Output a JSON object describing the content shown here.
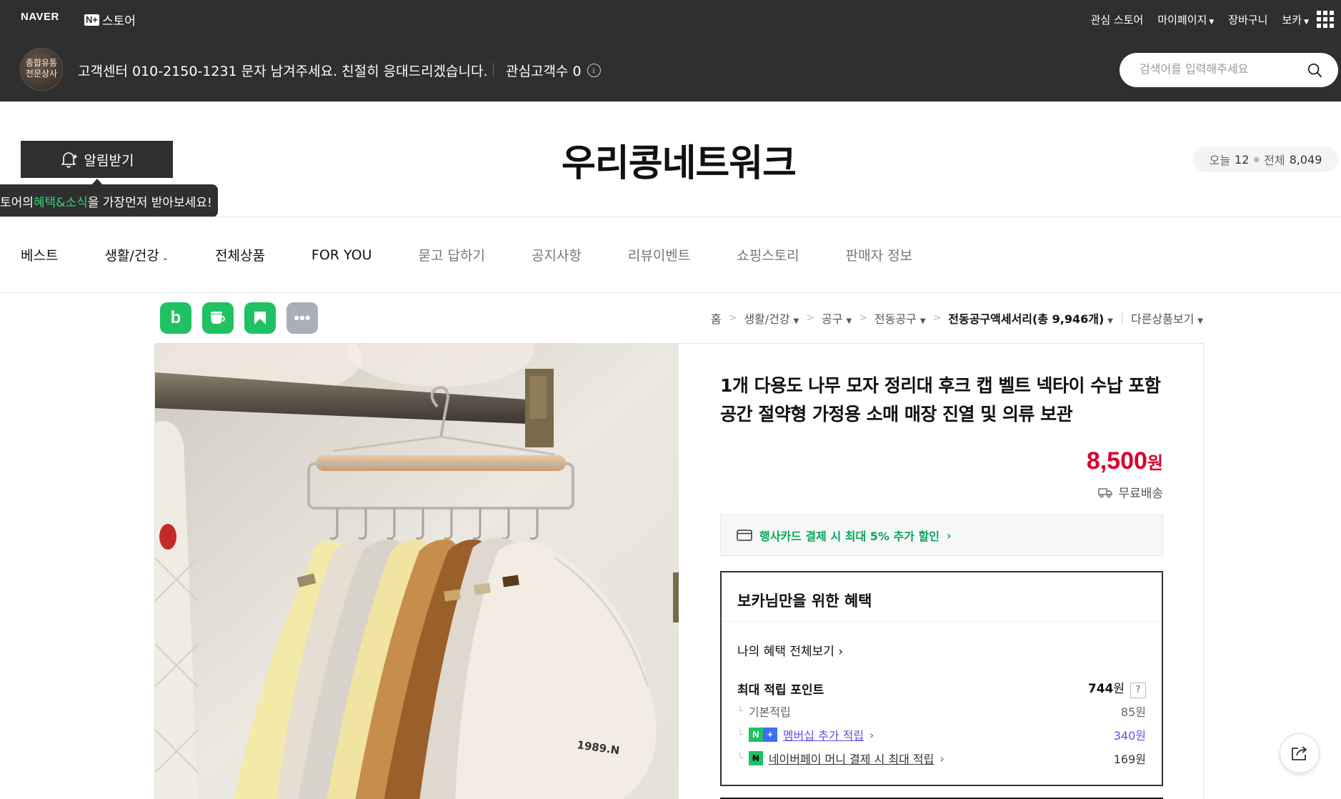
{
  "topbar": {
    "naver_logo": "NAVER",
    "nplus_badge": "N+",
    "nplus_store": "스토어",
    "menu": [
      "관심 스토어",
      "마이페이지",
      "장바구니",
      "보카"
    ],
    "store_avatar_text": "종합유통\n전문상사",
    "customer_center": "고객센터 010-2150-1231 문자 남겨주세요. 친절히 응대드리겠습니다.",
    "fav_customers": "관심고객수 0",
    "search_placeholder": "검색어를 입력해주세요"
  },
  "header": {
    "alarm_button": "알림받기",
    "tooltip_pre": "토어의 ",
    "tooltip_hl": "혜택&소식",
    "tooltip_post": "을 가장먼저 받아보세요!",
    "store_name": "우리콩네트워크",
    "today_label": "오늘",
    "today_count": "12",
    "total_label": "전체",
    "total_count": "8,049"
  },
  "nav": {
    "items": [
      "베스트",
      "생활/건강",
      "전체상품",
      "FOR YOU",
      "묻고 답하기",
      "공지사항",
      "리뷰이벤트",
      "쇼핑스토리",
      "판매자 정보"
    ]
  },
  "breadcrumb": {
    "home": "홈",
    "cat1": "생활/건강",
    "cat2": "공구",
    "cat3": "전동공구",
    "cat4": "전동공구액세서리(총 9,946개)",
    "other": "다른상품보기"
  },
  "product": {
    "title": "1개 다용도 나무 모자 정리대 후크 캡 벨트 넥타이 수납 포함 공간 절약형 가정용 소매 매장 진열 및 의류 보관",
    "price": "8,500",
    "price_unit": "원",
    "shipping": "무료배송",
    "card_promo": "행사카드 결제 시 최대 5% 추가 할인",
    "cap_text": "1989.N"
  },
  "benefit": {
    "title": "보카님만을 위한 혜택",
    "view_all": "나의 혜택 전체보기",
    "max_points_label": "최대 적립 포인트",
    "max_points_value": "744",
    "max_points_unit": "원",
    "help": "?",
    "basic_label": "기본적립",
    "basic_value": "85원",
    "membership_label": "멤버십 추가 적립",
    "membership_value": "340원",
    "naverpay_label": "네이버페이 머니 결제 시 최대 적립",
    "naverpay_value": "169원"
  },
  "colors": {
    "topbar": "#2f2f2f",
    "naver_green": "#1fc162",
    "price_red": "#d9002a",
    "promo_green": "#0aa55a",
    "membership_purple": "#6f48e0"
  }
}
